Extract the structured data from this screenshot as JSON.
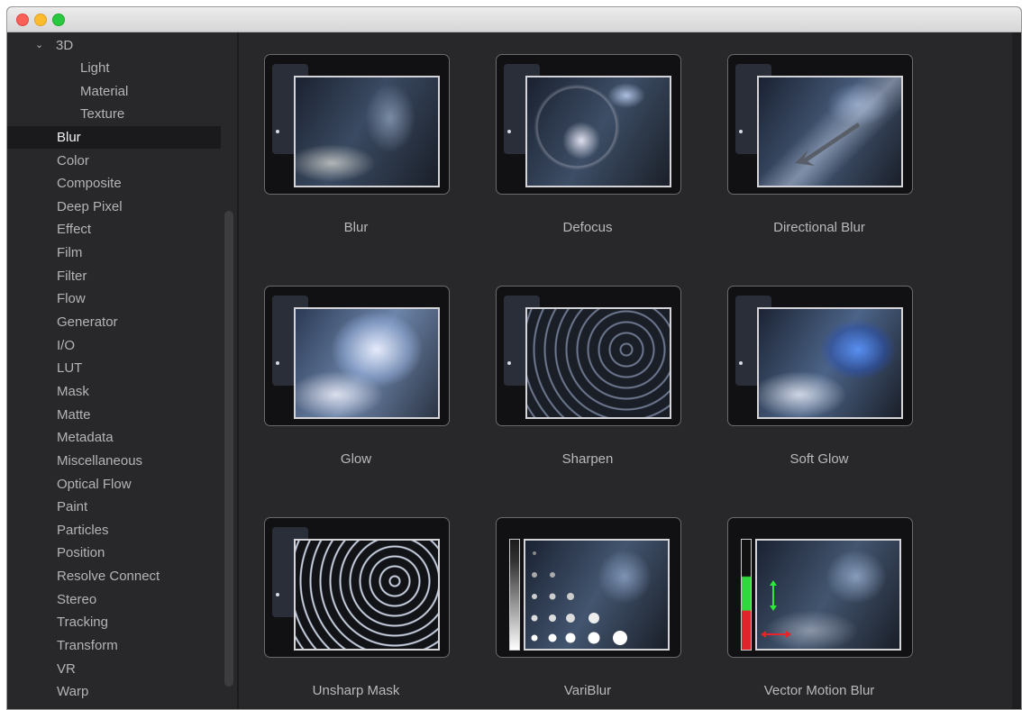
{
  "sidebar": {
    "items": [
      {
        "label": "3D",
        "expanded": true
      },
      {
        "label": "Light"
      },
      {
        "label": "Material"
      },
      {
        "label": "Texture"
      },
      {
        "label": "Blur",
        "selected": true
      },
      {
        "label": "Color"
      },
      {
        "label": "Composite"
      },
      {
        "label": "Deep Pixel"
      },
      {
        "label": "Effect"
      },
      {
        "label": "Film"
      },
      {
        "label": "Filter"
      },
      {
        "label": "Flow"
      },
      {
        "label": "Generator"
      },
      {
        "label": "I/O"
      },
      {
        "label": "LUT"
      },
      {
        "label": "Mask"
      },
      {
        "label": "Matte"
      },
      {
        "label": "Metadata"
      },
      {
        "label": "Miscellaneous"
      },
      {
        "label": "Optical Flow"
      },
      {
        "label": "Paint"
      },
      {
        "label": "Particles"
      },
      {
        "label": "Position"
      },
      {
        "label": "Resolve Connect"
      },
      {
        "label": "Stereo"
      },
      {
        "label": "Tracking"
      },
      {
        "label": "Transform"
      },
      {
        "label": "VR"
      },
      {
        "label": "Warp"
      }
    ]
  },
  "tools": [
    {
      "label": "Blur"
    },
    {
      "label": "Defocus"
    },
    {
      "label": "Directional Blur"
    },
    {
      "label": "Glow"
    },
    {
      "label": "Sharpen"
    },
    {
      "label": "Soft Glow"
    },
    {
      "label": "Unsharp Mask"
    },
    {
      "label": "VariBlur"
    },
    {
      "label": "Vector Motion Blur"
    }
  ],
  "colors": {
    "window_bg": "#28282b",
    "selected_row": "#1a1a1c",
    "text": "#b4b4b6",
    "frame": "#d4d4d8"
  }
}
